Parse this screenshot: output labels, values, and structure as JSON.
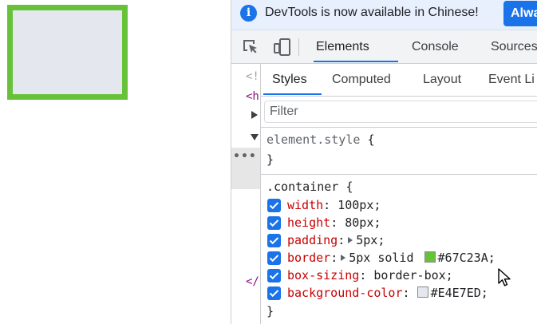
{
  "page": {
    "box_border_color": "#67C23A",
    "box_background": "#E4E7ED"
  },
  "infobar": {
    "message": "DevTools is now available in Chinese!",
    "button": "Alwa"
  },
  "main_tabs": [
    "Elements",
    "Console",
    "Sources"
  ],
  "sub_tabs": [
    "Styles",
    "Computed",
    "Layout",
    "Event Li"
  ],
  "filter": {
    "placeholder": "Filter"
  },
  "dom_fragments": [
    "<!",
    "<h",
    "</"
  ],
  "element_style": {
    "selector": "element.style",
    "open": "{",
    "close": "}"
  },
  "rule": {
    "selector": ".container",
    "open": "{",
    "close": "}",
    "declarations": [
      {
        "prop": "width",
        "value": "100px;",
        "has_triangle": false
      },
      {
        "prop": "height",
        "value": "80px;",
        "has_triangle": false
      },
      {
        "prop": "padding",
        "value": "5px;",
        "has_triangle": true
      },
      {
        "prop": "border",
        "value": "5px solid ",
        "has_triangle": true,
        "swatch": "#67C23A",
        "color_text": "#67C23A;"
      },
      {
        "prop": "box-sizing",
        "value": "border-box;",
        "has_triangle": false
      },
      {
        "prop": "background-color",
        "value": "",
        "has_triangle": false,
        "swatch": "#E4E7ED",
        "color_text": "#E4E7ED;"
      }
    ]
  }
}
